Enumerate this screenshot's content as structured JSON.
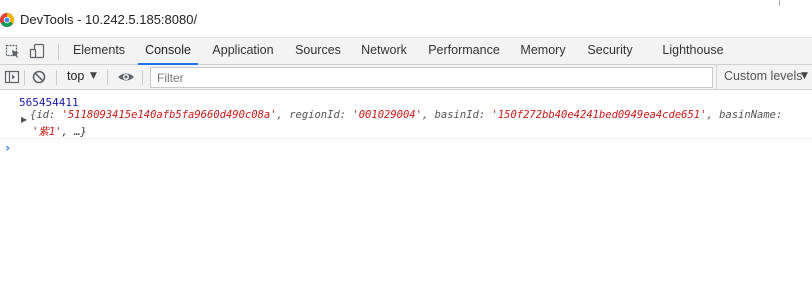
{
  "window": {
    "title": "DevTools - 10.242.5.185:8080/"
  },
  "tabs": [
    {
      "label": "Elements"
    },
    {
      "label": "Console"
    },
    {
      "label": "Application"
    },
    {
      "label": "Sources"
    },
    {
      "label": "Network"
    },
    {
      "label": "Performance"
    },
    {
      "label": "Memory"
    },
    {
      "label": "Security"
    },
    {
      "label": "Lighthouse"
    }
  ],
  "active_tab": "Console",
  "console_toolbar": {
    "context": "top",
    "filter_placeholder": "Filter",
    "filter_value": "",
    "levels_label": "Custom levels"
  },
  "log": {
    "number": "565454411",
    "object_open": "{id: ",
    "id_value": "'5118093415e140afb5fa9660d490c08a'",
    "sep1": ", regionId: ",
    "region_value": "'001029004'",
    "sep2": ", basinId: ",
    "basin_value": "'150f272bb40e4241bed0949ea4cde651'",
    "sep3": ", basinName: ",
    "line2_value": "'紫1'",
    "line2_tail": ", …}"
  },
  "colors": {
    "accent": "#1a73e8",
    "string": "#c41a16",
    "number": "#1a1aa6"
  }
}
